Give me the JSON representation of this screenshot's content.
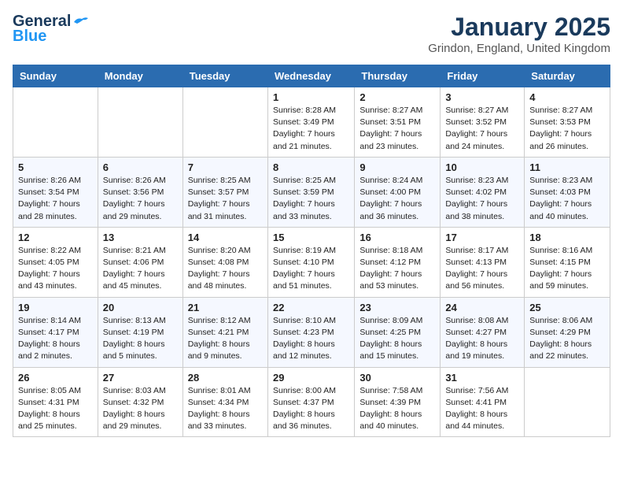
{
  "logo": {
    "general": "General",
    "blue": "Blue"
  },
  "title": "January 2025",
  "location": "Grindon, England, United Kingdom",
  "weekdays": [
    "Sunday",
    "Monday",
    "Tuesday",
    "Wednesday",
    "Thursday",
    "Friday",
    "Saturday"
  ],
  "weeks": [
    [
      {
        "day": "",
        "sunrise": "",
        "sunset": "",
        "daylight": ""
      },
      {
        "day": "",
        "sunrise": "",
        "sunset": "",
        "daylight": ""
      },
      {
        "day": "",
        "sunrise": "",
        "sunset": "",
        "daylight": ""
      },
      {
        "day": "1",
        "sunrise": "Sunrise: 8:28 AM",
        "sunset": "Sunset: 3:49 PM",
        "daylight": "Daylight: 7 hours and 21 minutes."
      },
      {
        "day": "2",
        "sunrise": "Sunrise: 8:27 AM",
        "sunset": "Sunset: 3:51 PM",
        "daylight": "Daylight: 7 hours and 23 minutes."
      },
      {
        "day": "3",
        "sunrise": "Sunrise: 8:27 AM",
        "sunset": "Sunset: 3:52 PM",
        "daylight": "Daylight: 7 hours and 24 minutes."
      },
      {
        "day": "4",
        "sunrise": "Sunrise: 8:27 AM",
        "sunset": "Sunset: 3:53 PM",
        "daylight": "Daylight: 7 hours and 26 minutes."
      }
    ],
    [
      {
        "day": "5",
        "sunrise": "Sunrise: 8:26 AM",
        "sunset": "Sunset: 3:54 PM",
        "daylight": "Daylight: 7 hours and 28 minutes."
      },
      {
        "day": "6",
        "sunrise": "Sunrise: 8:26 AM",
        "sunset": "Sunset: 3:56 PM",
        "daylight": "Daylight: 7 hours and 29 minutes."
      },
      {
        "day": "7",
        "sunrise": "Sunrise: 8:25 AM",
        "sunset": "Sunset: 3:57 PM",
        "daylight": "Daylight: 7 hours and 31 minutes."
      },
      {
        "day": "8",
        "sunrise": "Sunrise: 8:25 AM",
        "sunset": "Sunset: 3:59 PM",
        "daylight": "Daylight: 7 hours and 33 minutes."
      },
      {
        "day": "9",
        "sunrise": "Sunrise: 8:24 AM",
        "sunset": "Sunset: 4:00 PM",
        "daylight": "Daylight: 7 hours and 36 minutes."
      },
      {
        "day": "10",
        "sunrise": "Sunrise: 8:23 AM",
        "sunset": "Sunset: 4:02 PM",
        "daylight": "Daylight: 7 hours and 38 minutes."
      },
      {
        "day": "11",
        "sunrise": "Sunrise: 8:23 AM",
        "sunset": "Sunset: 4:03 PM",
        "daylight": "Daylight: 7 hours and 40 minutes."
      }
    ],
    [
      {
        "day": "12",
        "sunrise": "Sunrise: 8:22 AM",
        "sunset": "Sunset: 4:05 PM",
        "daylight": "Daylight: 7 hours and 43 minutes."
      },
      {
        "day": "13",
        "sunrise": "Sunrise: 8:21 AM",
        "sunset": "Sunset: 4:06 PM",
        "daylight": "Daylight: 7 hours and 45 minutes."
      },
      {
        "day": "14",
        "sunrise": "Sunrise: 8:20 AM",
        "sunset": "Sunset: 4:08 PM",
        "daylight": "Daylight: 7 hours and 48 minutes."
      },
      {
        "day": "15",
        "sunrise": "Sunrise: 8:19 AM",
        "sunset": "Sunset: 4:10 PM",
        "daylight": "Daylight: 7 hours and 51 minutes."
      },
      {
        "day": "16",
        "sunrise": "Sunrise: 8:18 AM",
        "sunset": "Sunset: 4:12 PM",
        "daylight": "Daylight: 7 hours and 53 minutes."
      },
      {
        "day": "17",
        "sunrise": "Sunrise: 8:17 AM",
        "sunset": "Sunset: 4:13 PM",
        "daylight": "Daylight: 7 hours and 56 minutes."
      },
      {
        "day": "18",
        "sunrise": "Sunrise: 8:16 AM",
        "sunset": "Sunset: 4:15 PM",
        "daylight": "Daylight: 7 hours and 59 minutes."
      }
    ],
    [
      {
        "day": "19",
        "sunrise": "Sunrise: 8:14 AM",
        "sunset": "Sunset: 4:17 PM",
        "daylight": "Daylight: 8 hours and 2 minutes."
      },
      {
        "day": "20",
        "sunrise": "Sunrise: 8:13 AM",
        "sunset": "Sunset: 4:19 PM",
        "daylight": "Daylight: 8 hours and 5 minutes."
      },
      {
        "day": "21",
        "sunrise": "Sunrise: 8:12 AM",
        "sunset": "Sunset: 4:21 PM",
        "daylight": "Daylight: 8 hours and 9 minutes."
      },
      {
        "day": "22",
        "sunrise": "Sunrise: 8:10 AM",
        "sunset": "Sunset: 4:23 PM",
        "daylight": "Daylight: 8 hours and 12 minutes."
      },
      {
        "day": "23",
        "sunrise": "Sunrise: 8:09 AM",
        "sunset": "Sunset: 4:25 PM",
        "daylight": "Daylight: 8 hours and 15 minutes."
      },
      {
        "day": "24",
        "sunrise": "Sunrise: 8:08 AM",
        "sunset": "Sunset: 4:27 PM",
        "daylight": "Daylight: 8 hours and 19 minutes."
      },
      {
        "day": "25",
        "sunrise": "Sunrise: 8:06 AM",
        "sunset": "Sunset: 4:29 PM",
        "daylight": "Daylight: 8 hours and 22 minutes."
      }
    ],
    [
      {
        "day": "26",
        "sunrise": "Sunrise: 8:05 AM",
        "sunset": "Sunset: 4:31 PM",
        "daylight": "Daylight: 8 hours and 25 minutes."
      },
      {
        "day": "27",
        "sunrise": "Sunrise: 8:03 AM",
        "sunset": "Sunset: 4:32 PM",
        "daylight": "Daylight: 8 hours and 29 minutes."
      },
      {
        "day": "28",
        "sunrise": "Sunrise: 8:01 AM",
        "sunset": "Sunset: 4:34 PM",
        "daylight": "Daylight: 8 hours and 33 minutes."
      },
      {
        "day": "29",
        "sunrise": "Sunrise: 8:00 AM",
        "sunset": "Sunset: 4:37 PM",
        "daylight": "Daylight: 8 hours and 36 minutes."
      },
      {
        "day": "30",
        "sunrise": "Sunrise: 7:58 AM",
        "sunset": "Sunset: 4:39 PM",
        "daylight": "Daylight: 8 hours and 40 minutes."
      },
      {
        "day": "31",
        "sunrise": "Sunrise: 7:56 AM",
        "sunset": "Sunset: 4:41 PM",
        "daylight": "Daylight: 8 hours and 44 minutes."
      },
      {
        "day": "",
        "sunrise": "",
        "sunset": "",
        "daylight": ""
      }
    ]
  ]
}
